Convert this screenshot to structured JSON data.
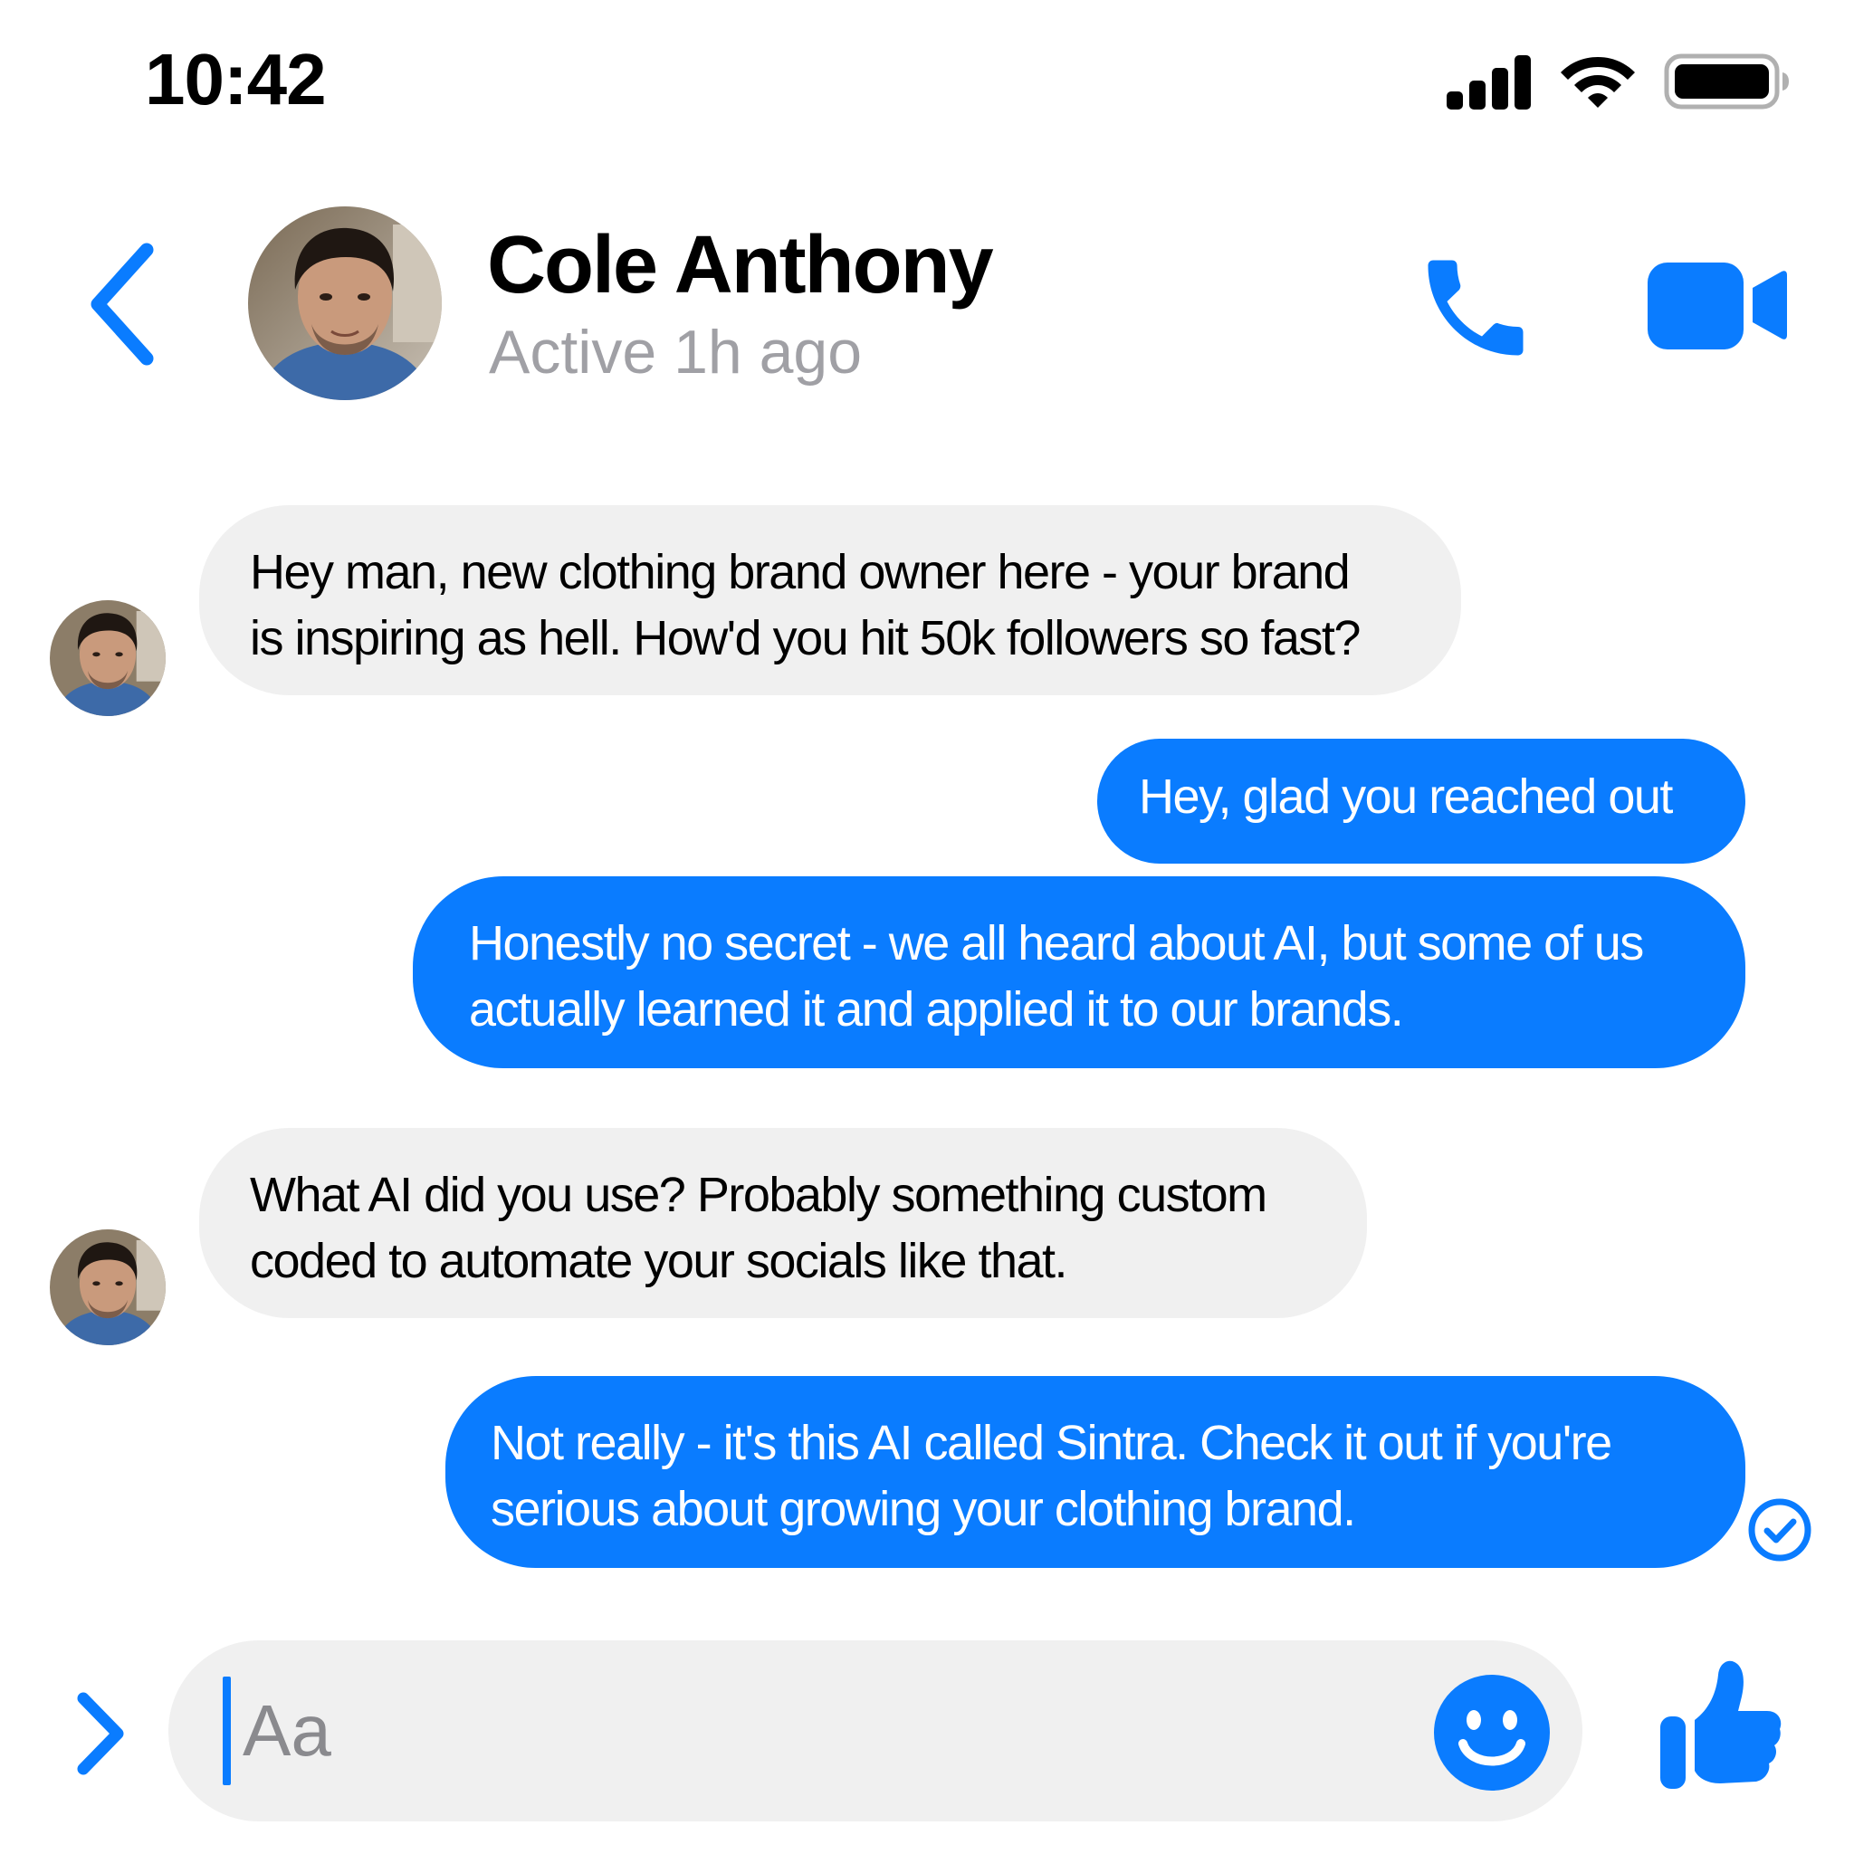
{
  "status_bar": {
    "time": "10:42",
    "icons": [
      "cellular-signal-icon",
      "wifi-icon",
      "battery-icon"
    ]
  },
  "header": {
    "contact_name": "Cole Anthony",
    "contact_status": "Active 1h ago",
    "icons": [
      "back-chevron-icon",
      "phone-icon",
      "video-camera-icon"
    ]
  },
  "messages": [
    {
      "direction": "incoming",
      "lines": [
        "Hey man, new clothing brand owner here - your brand",
        "is inspiring as hell. How'd you hit 50k followers so fast?"
      ]
    },
    {
      "direction": "outgoing",
      "lines": [
        "Hey, glad you reached out"
      ]
    },
    {
      "direction": "outgoing",
      "lines": [
        "Honestly no secret - we all heard about AI, but some of us",
        "actually learned it and applied it to our brands."
      ]
    },
    {
      "direction": "incoming",
      "lines": [
        "What AI did you use? Probably something custom",
        "coded to automate your socials like that."
      ]
    },
    {
      "direction": "outgoing",
      "lines": [
        "Not really - it's this AI called Sintra. Check it out if you're",
        "serious about growing your clothing brand."
      ]
    }
  ],
  "composer": {
    "placeholder": "Aa",
    "icons": [
      "expand-chevron-icon",
      "emoji-icon",
      "thumbs-up-icon"
    ]
  },
  "colors": {
    "accent": "#0a7cff",
    "incoming_bubble": "#f0f0f0",
    "secondary_text": "#a0a0a5"
  }
}
